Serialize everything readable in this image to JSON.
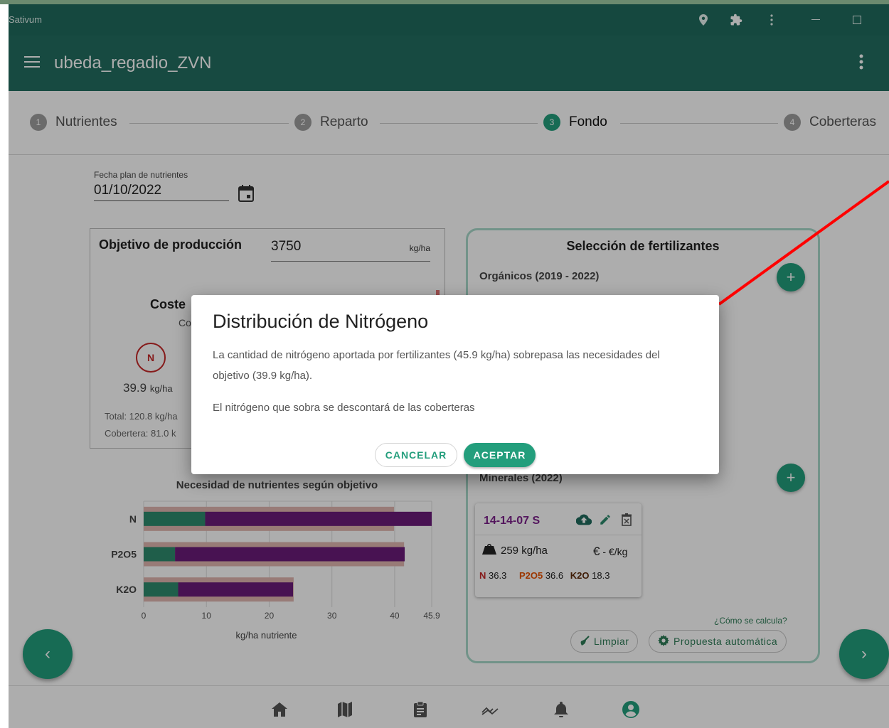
{
  "window": {
    "app_name": "Sativum",
    "title": "ubeda_regadio_ZVN"
  },
  "stepper": {
    "steps": [
      {
        "num": "1",
        "label": "Nutrientes"
      },
      {
        "num": "2",
        "label": "Reparto"
      },
      {
        "num": "3",
        "label": "Fondo",
        "active": true
      },
      {
        "num": "4",
        "label": "Coberteras"
      }
    ]
  },
  "date_field": {
    "label": "Fecha plan de nutrientes",
    "value": "01/10/2022"
  },
  "production": {
    "title": "Objetivo de producción",
    "value": "3750",
    "unit": "kg/ha",
    "coste_label": "Coste",
    "coste_sub": "Co",
    "n_symbol": "N",
    "n_value": "39.9",
    "n_unit": "kg/ha",
    "total": "Total: 120.8 kg/ha",
    "cobertera": "Cobertera: 81.0 k"
  },
  "chart_data": {
    "type": "bar",
    "title": "Necesidad de nutrientes según objetivo",
    "xlabel": "kg/ha nutriente",
    "ylabel": "",
    "categories": [
      "N",
      "P2O5",
      "K2O"
    ],
    "series": [
      {
        "values": [
          39.9,
          41.5,
          23.9
        ]
      },
      {
        "values": [
          9.8,
          5.0,
          5.5
        ]
      },
      {
        "values": [
          36.1,
          36.6,
          18.3
        ]
      }
    ],
    "xticks": [
      "0",
      "10",
      "20",
      "30",
      "40",
      "45.9"
    ],
    "xlim": [
      0,
      45.9
    ],
    "grid": true,
    "colors": {
      "need": "#e0b6b0",
      "organic": "#2e8b6e",
      "mineral": "#6a1b7a"
    }
  },
  "fertilizers": {
    "title": "Selección de fertilizantes",
    "organic_header": "Orgánicos (2019 - 2022)",
    "mineral_header": "Minerales (2022)",
    "add_icon": "+",
    "card": {
      "name": "14-14-07 S",
      "dose": "259 kg/ha",
      "price_symbol": "€",
      "price": "- €/kg",
      "n_label": "N",
      "n_value": "36.3",
      "p_label": "P2O5",
      "p_value": "36.6",
      "k_label": "K2O",
      "k_value": "18.3"
    },
    "how_calc": "¿Cómo se calcula?",
    "clear_label": "Limpiar",
    "auto_label": "Propuesta automática"
  },
  "nav": {
    "prev": "‹",
    "next": "›"
  },
  "dialog": {
    "title": "Distribución de Nitrógeno",
    "text1": "La cantidad de nitrógeno aportada por fertilizantes (45.9 kg/ha) sobrepasa las necesidades del objetivo (39.9 kg/ha).",
    "text2": "El nitrógeno que sobra se descontará de las coberteras",
    "cancel": "CANCELAR",
    "accept": "ACEPTAR"
  }
}
